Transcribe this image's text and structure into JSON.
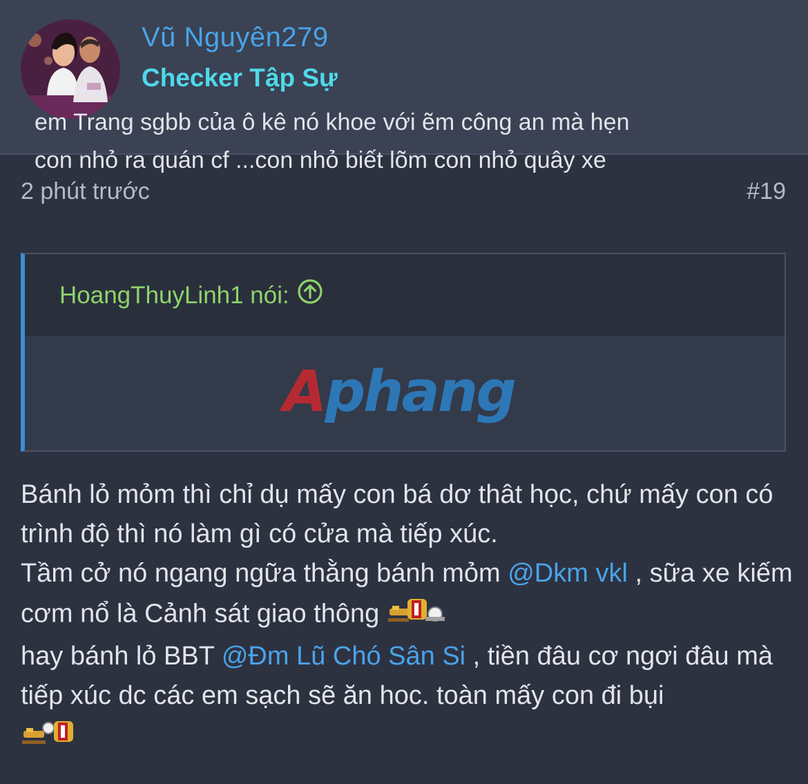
{
  "user": {
    "name": "Vũ Nguyên279",
    "title": "Checker Tập Sự"
  },
  "post": {
    "time": "2 phút trước",
    "number": "#19"
  },
  "quote": {
    "author": "HoangThuyLinh1 nói:",
    "line1": "em Trang sgbb của ô kê nó khoe với ẽm công an mà hẹn",
    "line2": "con nhỏ ra quán cf ...con nhỏ biết lõm con nhỏ quây xe"
  },
  "watermark": {
    "part1": "A",
    "part2": "phang"
  },
  "body": {
    "p1": "Bánh lỏ mỏm thì chỉ dụ mấy con bá dơ thât học, chứ mấy con có trình độ thì nó làm gì có cửa mà tiếp xúc.",
    "p2_before": "Tầm cở nó ngang ngữa thằng bánh mỏm ",
    "p2_mention": "@Dkm vkl",
    "p2_after": " , sữa xe kiếm cơm nổ là Cảnh sát giao thông ",
    "p3_before": "hay bánh lỏ BBT ",
    "p3_mention": "@Đm Lũ Chó Sân Si",
    "p3_after": " , tiền đâu cơ ngơi đâu mà tiếp xúc dc các em sạch sẽ ăn hoc. toàn mấy con đi bụi"
  },
  "icons": {
    "quote_jump": "arrow-up-circle-icon",
    "emoji": "motorbike-emoji-icon"
  },
  "colors": {
    "background": "#2d3241",
    "header_bg": "#3a4254",
    "username": "#4aa3e8",
    "usertitle": "#4fd8e8",
    "quote_author": "#8ed46a",
    "quote_border": "#3a8fd8",
    "mention": "#4aa3e8"
  }
}
